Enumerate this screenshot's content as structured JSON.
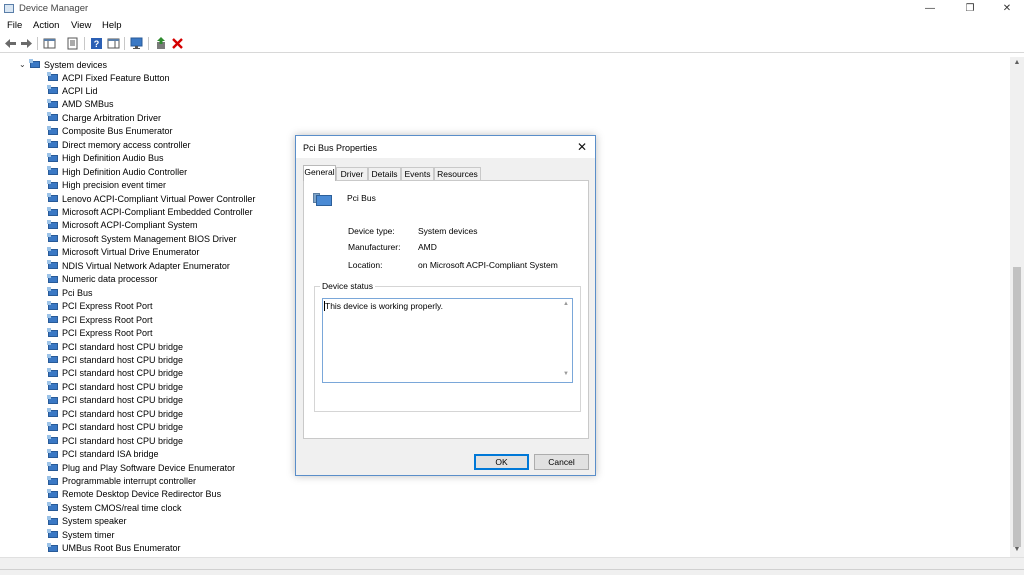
{
  "window": {
    "title": "Device Manager",
    "minimize_glyph": "—",
    "maximize_glyph": "❐",
    "close_glyph": "✕"
  },
  "menu": [
    "File",
    "Action",
    "View",
    "Help"
  ],
  "toolbar": {
    "icons": [
      "back-icon",
      "forward-icon",
      "show-hide-console-tree-icon",
      "properties-icon",
      "help-icon",
      "action-pane-icon",
      "scan-hardware-changes-icon",
      "update-driver-icon",
      "uninstall-device-icon"
    ],
    "uninstall_color": "#d40000",
    "update_color": "#2e8b2e"
  },
  "tree": {
    "root_label": "System devices",
    "expand_glyph": "⌄",
    "items": [
      "ACPI Fixed Feature Button",
      "ACPI Lid",
      "AMD SMBus",
      "Charge Arbitration Driver",
      "Composite Bus Enumerator",
      "Direct memory access controller",
      "High Definition Audio Bus",
      "High Definition Audio Controller",
      "High precision event timer",
      "Lenovo ACPI-Compliant Virtual Power Controller",
      "Microsoft ACPI-Compliant Embedded Controller",
      "Microsoft ACPI-Compliant System",
      "Microsoft System Management BIOS Driver",
      "Microsoft Virtual Drive Enumerator",
      "NDIS Virtual Network Adapter Enumerator",
      "Numeric data processor",
      "Pci Bus",
      "PCI Express Root Port",
      "PCI Express Root Port",
      "PCI Express Root Port",
      "PCI standard host CPU bridge",
      "PCI standard host CPU bridge",
      "PCI standard host CPU bridge",
      "PCI standard host CPU bridge",
      "PCI standard host CPU bridge",
      "PCI standard host CPU bridge",
      "PCI standard host CPU bridge",
      "PCI standard host CPU bridge",
      "PCI standard ISA bridge",
      "Plug and Play Software Device Enumerator",
      "Programmable interrupt controller",
      "Remote Desktop Device Redirector Bus",
      "System CMOS/real time clock",
      "System speaker",
      "System timer",
      "UMBus Root Bus Enumerator"
    ]
  },
  "dialog": {
    "title": "Pci Bus Properties",
    "close_glyph": "✕",
    "tabs": [
      "General",
      "Driver",
      "Details",
      "Events",
      "Resources"
    ],
    "active_tab": "General",
    "device_name": "Pci Bus",
    "properties": {
      "type_label": "Device type:",
      "type_value": "System devices",
      "manufacturer_label": "Manufacturer:",
      "manufacturer_value": "AMD",
      "location_label": "Location:",
      "location_value": "on Microsoft ACPI-Compliant System"
    },
    "status_group_label": "Device status",
    "status_text": "This device is working properly.",
    "ok_label": "OK",
    "cancel_label": "Cancel"
  },
  "scrollbar": {
    "up_glyph": "▲",
    "down_glyph": "▼"
  }
}
